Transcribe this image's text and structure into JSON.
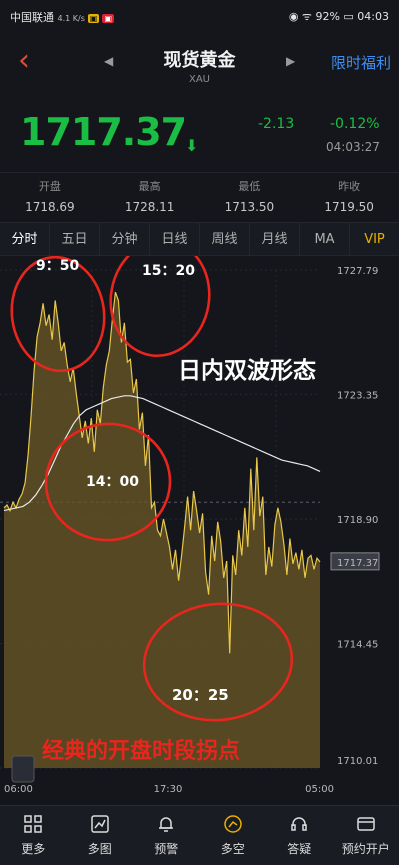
{
  "status": {
    "carrier": "中国联通",
    "net": "4.1 K/s",
    "battery": "92%",
    "clock": "04:03"
  },
  "header": {
    "title": "现货黄金",
    "symbol": "XAU",
    "promo": "限时福利"
  },
  "quote": {
    "price": "1717.37",
    "change": "-2.13",
    "change_pct": "-0.12%",
    "time": "04:03:27",
    "items": [
      {
        "label": "开盘",
        "value": "1718.69"
      },
      {
        "label": "最高",
        "value": "1728.11"
      },
      {
        "label": "最低",
        "value": "1713.50"
      },
      {
        "label": "昨收",
        "value": "1719.50"
      }
    ]
  },
  "tabs": [
    "分时",
    "五日",
    "分钟",
    "日线",
    "周线",
    "月线",
    "MA",
    "VIP"
  ],
  "chart_data": {
    "type": "area",
    "y_ticks": [
      "1727.79",
      "1723.35",
      "1718.90",
      "1717.37",
      "1714.45",
      "1710.01"
    ],
    "x_ticks": [
      "06:00",
      "17:30",
      "05:00"
    ],
    "ylim": [
      1710.01,
      1727.79
    ],
    "last_price": 1717.37,
    "prev_close": 1719.5,
    "colors": {
      "price": "#e9c84a",
      "fill": "#6b5a26",
      "avg": "#e8e8e8",
      "annotation": "#e8261e"
    },
    "series": [
      {
        "values": [
          1719.3,
          1719.4,
          1719.2,
          1719.5,
          1719.3,
          1719.6,
          1719.8,
          1720.2,
          1721.2,
          1722.6,
          1724.2,
          1725.4,
          1725.9,
          1726.6,
          1725.8,
          1726.2,
          1725.3,
          1726.7,
          1725.9,
          1724.9,
          1725.2,
          1724.4,
          1723.8,
          1724.3,
          1723.4,
          1722.6,
          1721.8,
          1722.4,
          1721.6,
          1722.5,
          1721.3,
          1722.8,
          1722.3,
          1723.6,
          1724.4,
          1724.9,
          1726.0,
          1727.0,
          1726.7,
          1725.2,
          1725.9,
          1724.5,
          1724.6,
          1723.4,
          1723.9,
          1722.1,
          1722.7,
          1720.8,
          1721.9,
          1719.3,
          1719.5,
          1718.5,
          1718.3,
          1718.9,
          1718.4,
          1717.9,
          1717.1,
          1717.8,
          1716.7,
          1717.6,
          1718.6,
          1719.7,
          1718.5,
          1719.9,
          1719.2,
          1718.4,
          1719.1,
          1717.0,
          1716.2,
          1718.3,
          1717.4,
          1718.8,
          1718.1,
          1716.8,
          1717.4,
          1714.1,
          1717.6,
          1716.9,
          1718.5,
          1717.6,
          1719.3,
          1717.9,
          1720.7,
          1718.5,
          1721.1,
          1719.0,
          1719.7,
          1716.9,
          1717.9,
          1717.2,
          1718.7,
          1719.3,
          1718.8,
          1718.0,
          1716.9,
          1718.2,
          1717.3,
          1717.7,
          1717.1,
          1717.8,
          1716.8,
          1717.5,
          1717.6,
          1717.1,
          1717.5,
          1717.37
        ]
      },
      {
        "values": [
          1719.2,
          1719.25,
          1719.3,
          1719.35,
          1719.5,
          1719.75,
          1720.1,
          1720.5,
          1721.0,
          1721.5,
          1721.9,
          1722.3,
          1722.6,
          1722.8,
          1722.9,
          1723.0,
          1723.1,
          1723.2,
          1723.25,
          1723.3,
          1723.3,
          1723.25,
          1723.2,
          1723.1,
          1723.0,
          1722.9,
          1722.8,
          1722.7,
          1722.6,
          1722.5,
          1722.4,
          1722.3,
          1722.2,
          1722.1,
          1722.0,
          1721.9,
          1721.8,
          1721.7,
          1721.6,
          1721.5,
          1721.4,
          1721.3,
          1721.2,
          1721.1,
          1721.0,
          1720.95,
          1720.9,
          1720.85,
          1720.8,
          1720.7,
          1720.6
        ]
      }
    ]
  },
  "annotations": {
    "t1": "9：50",
    "t2": "15：20",
    "t3": "14：00",
    "t4": "20：25",
    "headline": "日内双波形态",
    "footer": "经典的开盘时段拐点"
  },
  "nav": [
    "更多",
    "多图",
    "预警",
    "多空",
    "答疑",
    "预约开户"
  ]
}
